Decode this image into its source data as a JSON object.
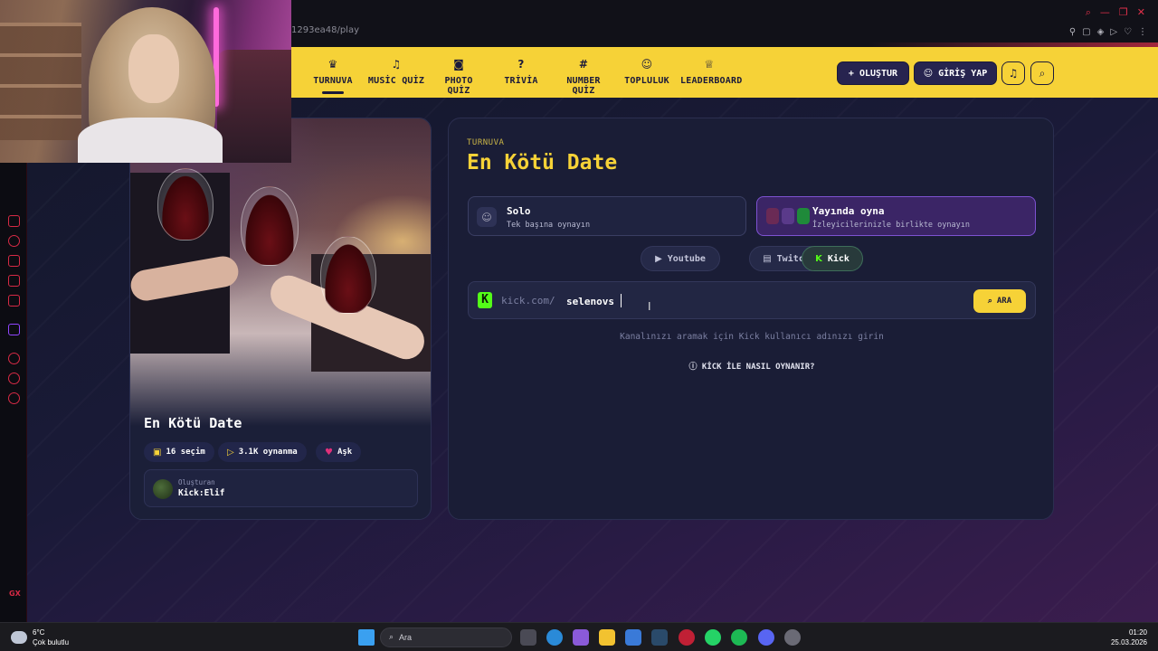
{
  "browser": {
    "url_fragment": "1293ea48/play"
  },
  "nav": {
    "items": [
      {
        "label": "TURNUVA",
        "icon": "trophy-icon",
        "glyph": "♛"
      },
      {
        "label": "MUSİC QUİZ",
        "icon": "music-icon",
        "glyph": "♫"
      },
      {
        "label": "PHOTO QUİZ",
        "icon": "camera-icon",
        "glyph": "◙"
      },
      {
        "label": "TRİVİA",
        "icon": "question-icon",
        "glyph": "?"
      },
      {
        "label": "NUMBER QUİZ",
        "icon": "hash-icon",
        "glyph": "#"
      },
      {
        "label": "TOPLULUK",
        "icon": "users-icon",
        "glyph": "☺"
      },
      {
        "label": "LEADERBOARD",
        "icon": "medal-icon",
        "glyph": "♕"
      }
    ],
    "create_label": "OLUŞTUR",
    "login_label": "GİRİŞ YAP"
  },
  "tournament_card": {
    "title": "En Kötü Date",
    "stats": {
      "choices": "16 seçim",
      "plays": "3.1K oynanma",
      "category": "Aşk"
    },
    "creator_label": "Oluşturan",
    "creator_name": "Kick:Elif"
  },
  "play_panel": {
    "kicker": "TURNUVA",
    "title": "En Kötü Date",
    "modes": {
      "solo_title": "Solo",
      "solo_sub": "Tek başına oynayın",
      "live_title": "Yayında oyna",
      "live_sub": "İzleyicilerinizle birlikte oynayın"
    },
    "platforms": {
      "youtube": "Youtube",
      "twitch": "Twitch",
      "kick": "Kick"
    },
    "search": {
      "prefix": "kick.com/",
      "value": "selenovs",
      "button": "ARA"
    },
    "hint": "Kanalınızı aramak için Kick kullanıcı adınızı girin",
    "howto": "KİCK İLE NASIL OYNANIR?"
  },
  "taskbar": {
    "temp": "6°C",
    "weather": "Çok bulutlu",
    "search_placeholder": "Ara",
    "time": "01:20",
    "date": "25.03.2026"
  },
  "sidebar": {
    "gx_label": "GX"
  },
  "colors": {
    "nav_yellow": "#f6d237",
    "navy": "#1b1a3a",
    "kick_green": "#53fc18",
    "live_purple": "#7d52d1",
    "opera_red": "#d62a45"
  }
}
